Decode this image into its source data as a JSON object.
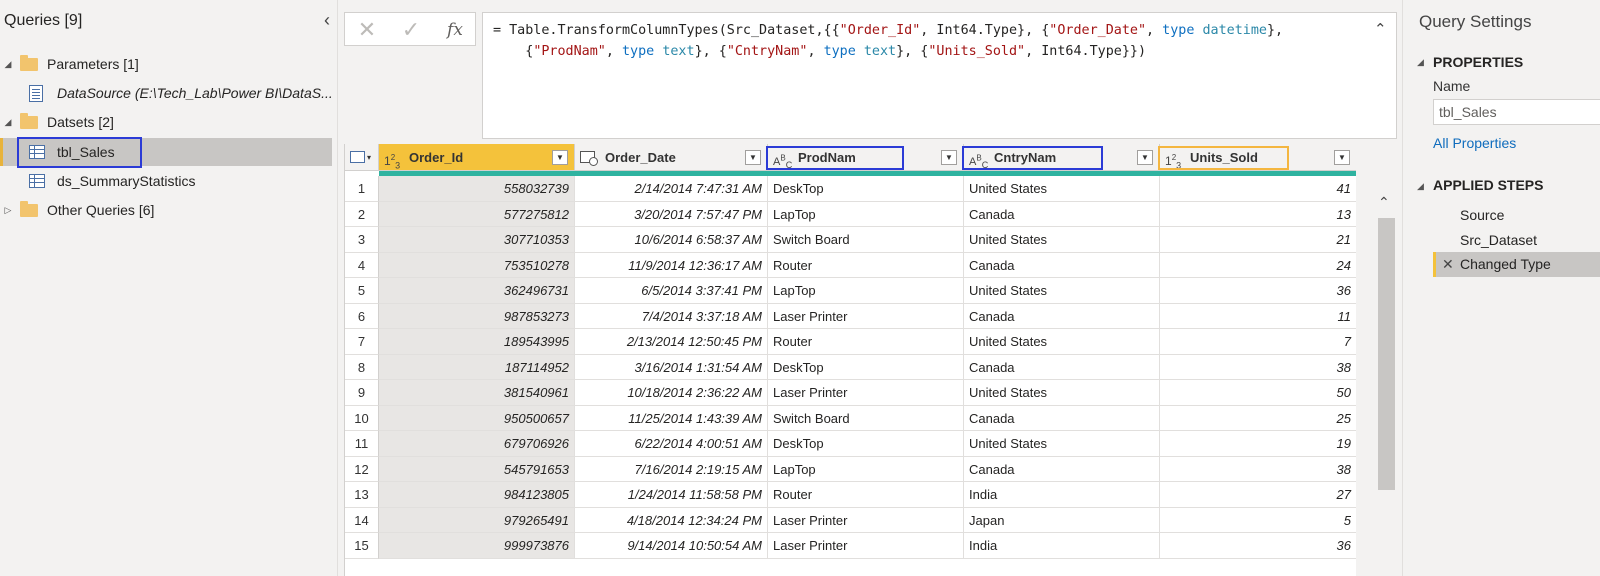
{
  "queries_pane": {
    "title": "Queries [9]",
    "groups": [
      {
        "label": "Parameters [1]",
        "children": [
          {
            "label": "DataSource (E:\\Tech_Lab\\Power BI\\DataS..."
          }
        ]
      },
      {
        "label": "Datsets [2]",
        "children": [
          {
            "label": "tbl_Sales"
          },
          {
            "label": "ds_SummaryStatistics"
          }
        ]
      },
      {
        "label": "Other Queries [6]",
        "children": []
      }
    ]
  },
  "formula": {
    "line1_prefix": "= Table.TransformColumnTypes(Src_Dataset,{{",
    "tokens": {
      "order_id": "\"Order_Id\"",
      "int64": "Int64.Type",
      "order_date": "\"Order_Date\"",
      "type": "type",
      "datetime": "datetime",
      "prodnam": "\"ProdNam\"",
      "text": "text",
      "cntrynam": "\"CntryNam\"",
      "units_sold": "\"Units_Sold\""
    }
  },
  "columns": [
    {
      "type_icon": "1²3",
      "name": "Order_Id"
    },
    {
      "type_icon": "date-time-icon",
      "name": "Order_Date"
    },
    {
      "type_icon": "ABC",
      "name": "ProdNam"
    },
    {
      "type_icon": "ABC",
      "name": "CntryNam"
    },
    {
      "type_icon": "1²3",
      "name": "Units_Sold"
    }
  ],
  "rows": [
    [
      "1",
      "558032739",
      "2/14/2014 7:47:31 AM",
      "DeskTop",
      "United States",
      "41"
    ],
    [
      "2",
      "577275812",
      "3/20/2014 7:57:47 PM",
      "LapTop",
      "Canada",
      "13"
    ],
    [
      "3",
      "307710353",
      "10/6/2014 6:58:37 AM",
      "Switch Board",
      "United States",
      "21"
    ],
    [
      "4",
      "753510278",
      "11/9/2014 12:36:17 AM",
      "Router",
      "Canada",
      "24"
    ],
    [
      "5",
      "362496731",
      "6/5/2014 3:37:41 PM",
      "LapTop",
      "United States",
      "36"
    ],
    [
      "6",
      "987853273",
      "7/4/2014 3:37:18 AM",
      "Laser Printer",
      "Canada",
      "11"
    ],
    [
      "7",
      "189543995",
      "2/13/2014 12:50:45 PM",
      "Router",
      "United States",
      "7"
    ],
    [
      "8",
      "187114952",
      "3/16/2014 1:31:54 AM",
      "DeskTop",
      "Canada",
      "38"
    ],
    [
      "9",
      "381540961",
      "10/18/2014 2:36:22 AM",
      "Laser Printer",
      "United States",
      "50"
    ],
    [
      "10",
      "950500657",
      "11/25/2014 1:43:39 AM",
      "Switch Board",
      "Canada",
      "25"
    ],
    [
      "11",
      "679706926",
      "6/22/2014 4:00:51 AM",
      "DeskTop",
      "United States",
      "19"
    ],
    [
      "12",
      "545791653",
      "7/16/2014 2:19:15 AM",
      "LapTop",
      "Canada",
      "38"
    ],
    [
      "13",
      "984123805",
      "1/24/2014 11:58:58 PM",
      "Router",
      "India",
      "27"
    ],
    [
      "14",
      "979265491",
      "4/18/2014 12:34:24 PM",
      "Laser Printer",
      "Japan",
      "5"
    ],
    [
      "15",
      "999973876",
      "9/14/2014 10:50:54 AM",
      "Laser Printer",
      "India",
      "36"
    ]
  ],
  "settings": {
    "title": "Query Settings",
    "properties_label": "PROPERTIES",
    "name_label": "Name",
    "name_value": "tbl_Sales",
    "all_properties": "All Properties",
    "applied_steps_label": "APPLIED STEPS",
    "steps": [
      "Source",
      "Src_Dataset",
      "Changed Type"
    ]
  },
  "colors": {
    "selected_column": "#f4c23b",
    "highlight_box": "#2b3bd6",
    "quality_bar": "#2fb3a0"
  }
}
